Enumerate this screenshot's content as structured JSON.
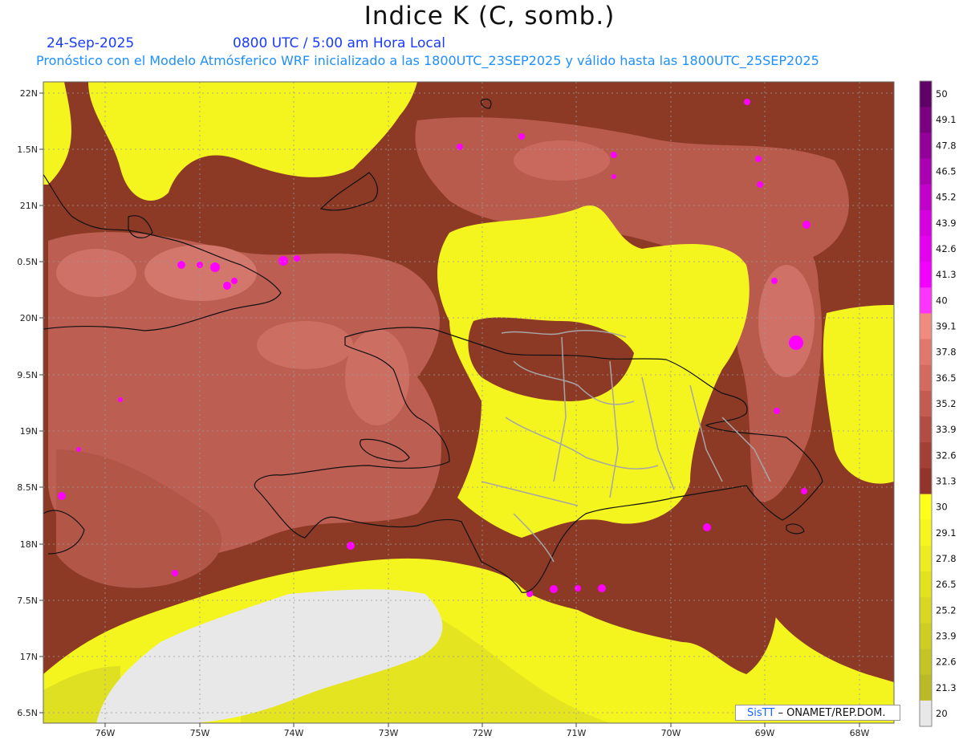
{
  "header": {
    "title": "Indice K (C, somb.)",
    "date": "24-Sep-2025",
    "time": "0800 UTC / 5:00 am Hora Local",
    "subtitle": "Pronóstico con el Modelo Atmósferico WRF inicializado a las 1800UTC_23SEP2025 y válido hasta las  1800UTC_25SEP2025"
  },
  "axes": {
    "lat_labels": [
      "22N",
      "1.5N",
      "21N",
      "0.5N",
      "20N",
      "9.5N",
      "19N",
      "8.5N",
      "18N",
      "7.5N",
      "17N",
      "6.5N"
    ],
    "lon_labels": [
      "76W",
      "75W",
      "74W",
      "73W",
      "72W",
      "71W",
      "70W",
      "69W",
      "68W"
    ]
  },
  "colorbar": {
    "labels": [
      "50",
      "49.1",
      "47.8",
      "46.5",
      "45.2",
      "43.9",
      "42.6",
      "41.3",
      "40",
      "39.1",
      "37.8",
      "36.5",
      "35.2",
      "33.9",
      "32.6",
      "31.3",
      "30",
      "29.1",
      "27.8",
      "26.5",
      "25.2",
      "23.9",
      "22.6",
      "21.3",
      "20"
    ],
    "colors": [
      "#5e0066",
      "#7a007f",
      "#930099",
      "#aa00b2",
      "#c200cc",
      "#d600e0",
      "#e600f0",
      "#f300ff",
      "#ff33ff",
      "#f08b7e",
      "#e2786c",
      "#d4695e",
      "#c45b50",
      "#b34c42",
      "#a23f36",
      "#92342b",
      "#ffff1a",
      "#f6f61c",
      "#ecec1e",
      "#e2e21f",
      "#d8d820",
      "#cece22",
      "#c4c424",
      "#baba26",
      "#e8e8e8"
    ]
  },
  "map_colors": {
    "yellow": "#f4f41e",
    "brown": "#8c3a26",
    "salmon": "#c0615a",
    "pink": "#d9756c",
    "magenta": "#ff00ff",
    "gray": "#e8e8e8"
  },
  "credit": {
    "brand": "SisTT",
    "text": "– ONAMET/REP.DOM."
  }
}
